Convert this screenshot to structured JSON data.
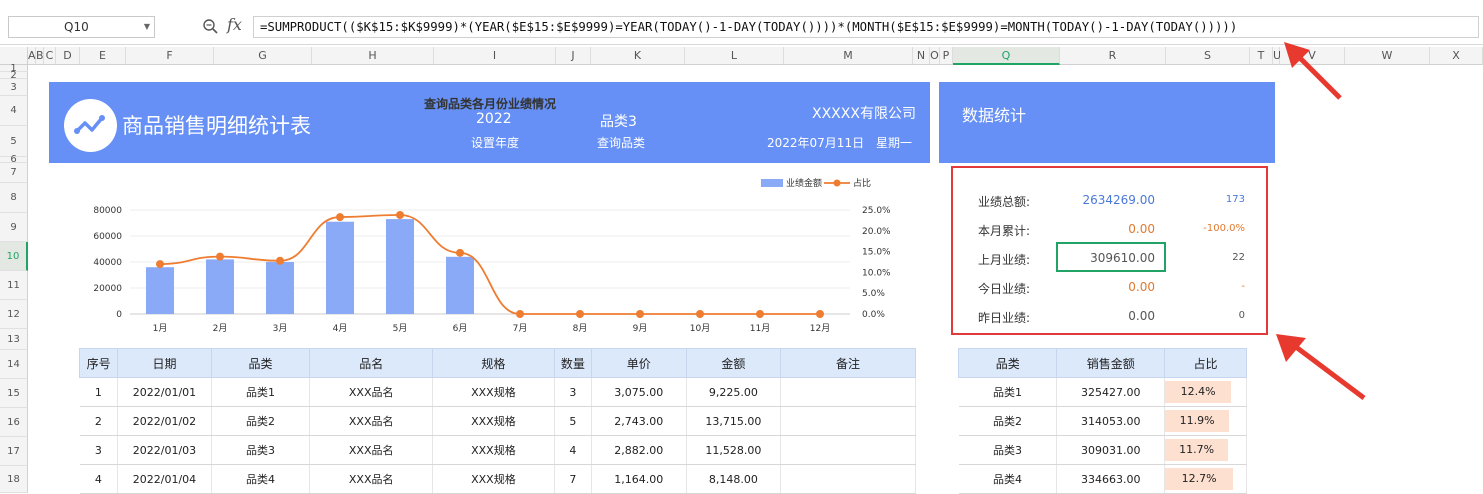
{
  "formula_bar": {
    "name_box": "Q10",
    "fx_label": "fx",
    "formula": "=SUMPRODUCT(($K$15:$K$9999)*(YEAR($E$15:$E$9999)=YEAR(TODAY()-1-DAY(TODAY())))*(MONTH($E$15:$E$9999)=MONTH(TODAY()-1-DAY(TODAY()))))"
  },
  "columns": [
    "A",
    "B",
    "C",
    "D",
    "E",
    "F",
    "G",
    "H",
    "I",
    "J",
    "K",
    "L",
    "M",
    "N",
    "O",
    "P",
    "Q",
    "R",
    "S",
    "T",
    "U",
    "V",
    "W",
    "X"
  ],
  "rows": [
    "1",
    "2",
    "3",
    "4",
    "5",
    "6",
    "7",
    "8",
    "9",
    "10",
    "11",
    "12",
    "13",
    "14",
    "15",
    "16",
    "17",
    "18"
  ],
  "header": {
    "title": "商品销售明细统计表",
    "year_value": "2022",
    "year_label": "设置年度",
    "category_value": "品类3",
    "category_label": "查询品类",
    "company": "XXXXX有限公司",
    "date": "2022年07月11日",
    "weekday": "星期一",
    "stats_title": "数据统计"
  },
  "chart_data": {
    "type": "bar",
    "title": "查询品类各月份业绩情况",
    "categories": [
      "1月",
      "2月",
      "3月",
      "4月",
      "5月",
      "6月",
      "7月",
      "8月",
      "9月",
      "10月",
      "11月",
      "12月"
    ],
    "series": [
      {
        "name": "业绩金额",
        "type": "bar",
        "values": [
          36000,
          42000,
          40000,
          71000,
          73000,
          44000,
          0,
          0,
          0,
          0,
          0,
          0
        ]
      },
      {
        "name": "占比",
        "type": "line",
        "values": [
          0.12,
          0.138,
          0.128,
          0.233,
          0.238,
          0.147,
          0,
          0,
          0,
          0,
          0,
          0
        ]
      }
    ],
    "y_left_ticks": [
      "80000",
      "60000",
      "40000",
      "20000",
      "0"
    ],
    "y_right_ticks": [
      "25.0%",
      "20.0%",
      "15.0%",
      "10.0%",
      "5.0%",
      "0.0%"
    ],
    "ylim": [
      0,
      80000
    ],
    "y2lim": [
      0,
      0.25
    ],
    "legend": "top-right",
    "colors": {
      "bar": "#8aa9f7",
      "line": "#ee7d31"
    }
  },
  "stats": [
    {
      "label": "业绩总额:",
      "value": "2634269.00",
      "extra": "173",
      "value_color": "#4a78d8",
      "extra_color": "#4a78d8"
    },
    {
      "label": "本月累计:",
      "value": "0.00",
      "extra": "-100.0%",
      "value_color": "#e07a2f",
      "extra_color": "#e07a2f"
    },
    {
      "label": "上月业绩:",
      "value": "309610.00",
      "extra": "22",
      "value_color": "#555555",
      "extra_color": "#555555"
    },
    {
      "label": "今日业绩:",
      "value": "0.00",
      "extra": "-",
      "value_color": "#e07a2f",
      "extra_color": "#e07a2f"
    },
    {
      "label": "昨日业绩:",
      "value": "0.00",
      "extra": "0",
      "value_color": "#555555",
      "extra_color": "#555555"
    }
  ],
  "detail_table": {
    "headers": [
      "序号",
      "日期",
      "品类",
      "品名",
      "规格",
      "数量",
      "单价",
      "金额",
      "备注"
    ],
    "rows": [
      [
        "1",
        "2022/01/01",
        "品类1",
        "XXX品名",
        "XXX规格",
        "3",
        "3,075.00",
        "9,225.00",
        ""
      ],
      [
        "2",
        "2022/01/02",
        "品类2",
        "XXX品名",
        "XXX规格",
        "5",
        "2,743.00",
        "13,715.00",
        ""
      ],
      [
        "3",
        "2022/01/03",
        "品类3",
        "XXX品名",
        "XXX规格",
        "4",
        "2,882.00",
        "11,528.00",
        ""
      ],
      [
        "4",
        "2022/01/04",
        "品类4",
        "XXX品名",
        "XXX规格",
        "7",
        "1,164.00",
        "8,148.00",
        ""
      ]
    ]
  },
  "summary_table": {
    "headers": [
      "品类",
      "销售金额",
      "占比"
    ],
    "rows": [
      [
        "品类1",
        "325427.00",
        "12.4%"
      ],
      [
        "品类2",
        "314053.00",
        "11.9%"
      ],
      [
        "品类3",
        "309031.00",
        "11.7%"
      ],
      [
        "品类4",
        "334663.00",
        "12.7%"
      ]
    ],
    "pct_fill": [
      0.124,
      0.119,
      0.117,
      0.127
    ]
  }
}
